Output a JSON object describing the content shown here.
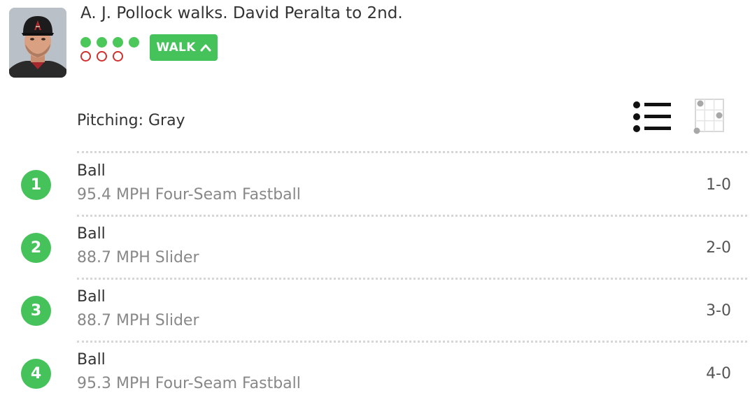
{
  "play": {
    "headline": "A. J. Pollock walks. David Peralta to 2nd.",
    "result_badge": "WALK",
    "balls": 4,
    "outs_slots": 3
  },
  "pitching": {
    "label": "Pitching: Gray"
  },
  "icons": {
    "list_view": "list-icon",
    "zone_view": "strike-zone-icon",
    "collapse": "chevron-up-icon"
  },
  "colors": {
    "ball_green": "#45c35a",
    "out_red": "#d0312d",
    "text_dark": "#333333",
    "text_muted": "#888888"
  },
  "pitches": [
    {
      "number": "1",
      "result": "Ball",
      "description": "95.4 MPH Four-Seam Fastball",
      "count": "1-0"
    },
    {
      "number": "2",
      "result": "Ball",
      "description": "88.7 MPH Slider",
      "count": "2-0"
    },
    {
      "number": "3",
      "result": "Ball",
      "description": "88.7 MPH Slider",
      "count": "3-0"
    },
    {
      "number": "4",
      "result": "Ball",
      "description": "95.3 MPH Four-Seam Fastball",
      "count": "4-0"
    }
  ]
}
